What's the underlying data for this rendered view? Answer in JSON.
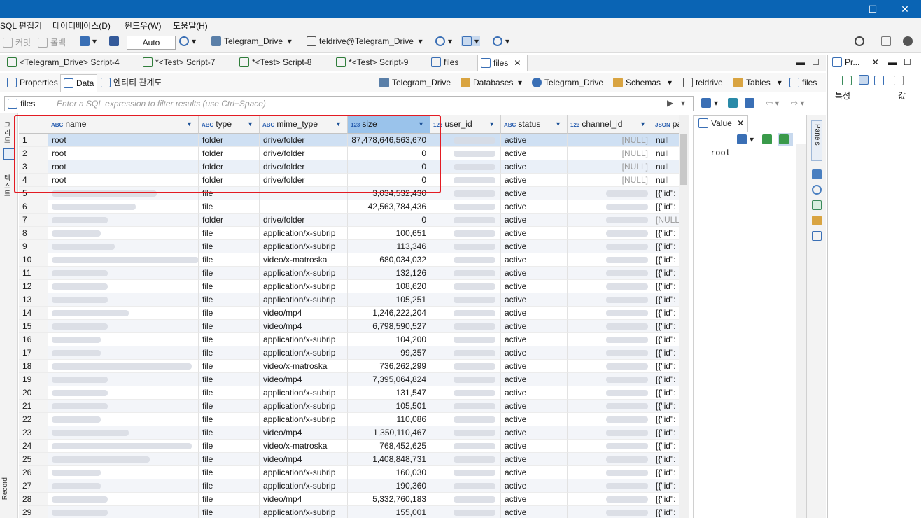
{
  "window": {
    "minimize": "—",
    "maximize": "☐",
    "close": "✕"
  },
  "menu": [
    "SQL 편집기",
    "데이터베이스(D)",
    "윈도우(W)",
    "도움말(H)"
  ],
  "toolbar": {
    "commit": "커밋",
    "rollback": "롤백",
    "tx_mode": "Auto",
    "datasource": "Telegram_Drive",
    "schema": "teldrive@Telegram_Drive"
  },
  "editor_tabs": [
    {
      "label": "<Telegram_Drive> Script-4"
    },
    {
      "label": "*<Test> Script-7"
    },
    {
      "label": "*<Test> Script-8"
    },
    {
      "label": "*<Test> Script-9"
    },
    {
      "label": "files"
    },
    {
      "label": "files"
    }
  ],
  "subtabs": {
    "properties": "Properties",
    "data": "Data",
    "er": "엔티티 관계도"
  },
  "breadcrumb": [
    "Telegram_Drive",
    "Databases",
    "Telegram_Drive",
    "Schemas",
    "teldrive",
    "Tables",
    "files"
  ],
  "filter": {
    "label": "files",
    "placeholder": "Enter a SQL expression to filter results (use Ctrl+Space)"
  },
  "left_tabs": {
    "grid": "그리드",
    "text": "텍스트",
    "record": "Record"
  },
  "grid": {
    "columns": [
      {
        "type": "ABC",
        "label": "name"
      },
      {
        "type": "ABC",
        "label": "type"
      },
      {
        "type": "ABC",
        "label": "mime_type"
      },
      {
        "type": "123",
        "label": "size"
      },
      {
        "type": "123",
        "label": "user_id"
      },
      {
        "type": "ABC",
        "label": "status"
      },
      {
        "type": "123",
        "label": "channel_id"
      },
      {
        "type": "JSON",
        "label": "pa"
      }
    ],
    "rows": [
      {
        "n": "1",
        "name": "root",
        "type": "folder",
        "mime": "drive/folder",
        "size": "87,478,646,563,670",
        "status": "active",
        "channel": "[NULL]",
        "parts": "null"
      },
      {
        "n": "2",
        "name": "root",
        "type": "folder",
        "mime": "drive/folder",
        "size": "0",
        "status": "active",
        "channel": "[NULL]",
        "parts": "null"
      },
      {
        "n": "3",
        "name": "root",
        "type": "folder",
        "mime": "drive/folder",
        "size": "0",
        "status": "active",
        "channel": "[NULL]",
        "parts": "null"
      },
      {
        "n": "4",
        "name": "root",
        "type": "folder",
        "mime": "drive/folder",
        "size": "0",
        "status": "active",
        "channel": "[NULL]",
        "parts": "null"
      },
      {
        "n": "5",
        "name": "",
        "type": "file",
        "mime": "",
        "size": "3,034,532,430",
        "status": "active",
        "channel": "",
        "parts": "[{\"id\":"
      },
      {
        "n": "6",
        "name": "",
        "type": "file",
        "mime": "",
        "size": "42,563,784,436",
        "status": "active",
        "channel": "",
        "parts": "[{\"id\":"
      },
      {
        "n": "7",
        "name": "",
        "type": "folder",
        "mime": "drive/folder",
        "size": "0",
        "status": "active",
        "channel": "",
        "parts": "[NULL]"
      },
      {
        "n": "8",
        "name": "",
        "type": "file",
        "mime": "application/x-subrip",
        "size": "100,651",
        "status": "active",
        "channel": "",
        "parts": "[{\"id\":"
      },
      {
        "n": "9",
        "name": "",
        "type": "file",
        "mime": "application/x-subrip",
        "size": "113,346",
        "status": "active",
        "channel": "",
        "parts": "[{\"id\":"
      },
      {
        "n": "10",
        "name": "",
        "type": "file",
        "mime": "video/x-matroska",
        "size": "680,034,032",
        "status": "active",
        "channel": "",
        "parts": "[{\"id\":"
      },
      {
        "n": "11",
        "name": "",
        "type": "file",
        "mime": "application/x-subrip",
        "size": "132,126",
        "status": "active",
        "channel": "",
        "parts": "[{\"id\":"
      },
      {
        "n": "12",
        "name": "",
        "type": "file",
        "mime": "application/x-subrip",
        "size": "108,620",
        "status": "active",
        "channel": "",
        "parts": "[{\"id\":"
      },
      {
        "n": "13",
        "name": "",
        "type": "file",
        "mime": "application/x-subrip",
        "size": "105,251",
        "status": "active",
        "channel": "",
        "parts": "[{\"id\":"
      },
      {
        "n": "14",
        "name": "",
        "type": "file",
        "mime": "video/mp4",
        "size": "1,246,222,204",
        "status": "active",
        "channel": "",
        "parts": "[{\"id\":"
      },
      {
        "n": "15",
        "name": "",
        "type": "file",
        "mime": "video/mp4",
        "size": "6,798,590,527",
        "status": "active",
        "channel": "",
        "parts": "[{\"id\":"
      },
      {
        "n": "16",
        "name": "",
        "type": "file",
        "mime": "application/x-subrip",
        "size": "104,200",
        "status": "active",
        "channel": "",
        "parts": "[{\"id\":"
      },
      {
        "n": "17",
        "name": "",
        "type": "file",
        "mime": "application/x-subrip",
        "size": "99,357",
        "status": "active",
        "channel": "",
        "parts": "[{\"id\":"
      },
      {
        "n": "18",
        "name": "",
        "type": "file",
        "mime": "video/x-matroska",
        "size": "736,262,299",
        "status": "active",
        "channel": "",
        "parts": "[{\"id\":"
      },
      {
        "n": "19",
        "name": "",
        "type": "file",
        "mime": "video/mp4",
        "size": "7,395,064,824",
        "status": "active",
        "channel": "",
        "parts": "[{\"id\":"
      },
      {
        "n": "20",
        "name": "",
        "type": "file",
        "mime": "application/x-subrip",
        "size": "131,547",
        "status": "active",
        "channel": "",
        "parts": "[{\"id\":"
      },
      {
        "n": "21",
        "name": "",
        "type": "file",
        "mime": "application/x-subrip",
        "size": "105,501",
        "status": "active",
        "channel": "",
        "parts": "[{\"id\":"
      },
      {
        "n": "22",
        "name": "",
        "type": "file",
        "mime": "application/x-subrip",
        "size": "110,086",
        "status": "active",
        "channel": "",
        "parts": "[{\"id\":"
      },
      {
        "n": "23",
        "name": "",
        "type": "file",
        "mime": "video/mp4",
        "size": "1,350,110,467",
        "status": "active",
        "channel": "",
        "parts": "[{\"id\":"
      },
      {
        "n": "24",
        "name": "",
        "type": "file",
        "mime": "video/x-matroska",
        "size": "768,452,625",
        "status": "active",
        "channel": "",
        "parts": "[{\"id\":"
      },
      {
        "n": "25",
        "name": "",
        "type": "file",
        "mime": "video/mp4",
        "size": "1,408,848,731",
        "status": "active",
        "channel": "",
        "parts": "[{\"id\":"
      },
      {
        "n": "26",
        "name": "",
        "type": "file",
        "mime": "application/x-subrip",
        "size": "160,030",
        "status": "active",
        "channel": "",
        "parts": "[{\"id\":"
      },
      {
        "n": "27",
        "name": "",
        "type": "file",
        "mime": "application/x-subrip",
        "size": "190,360",
        "status": "active",
        "channel": "",
        "parts": "[{\"id\":"
      },
      {
        "n": "28",
        "name": "",
        "type": "file",
        "mime": "video/mp4",
        "size": "5,332,760,183",
        "status": "active",
        "channel": "",
        "parts": "[{\"id\":"
      },
      {
        "n": "29",
        "name": "",
        "type": "file",
        "mime": "application/x-subrip",
        "size": "155,001",
        "status": "active",
        "channel": "",
        "parts": "[{\"id\":"
      }
    ]
  },
  "value_panel": {
    "tab": "Value",
    "content": "root",
    "panels_label": "Panels"
  },
  "right_pane": {
    "tab": "Pr...",
    "col_property": "특성",
    "col_value": "값"
  },
  "colors": {
    "titlebar": "#0a64b4",
    "selected_header": "#9ac3eb",
    "highlight": "#e31b23"
  }
}
